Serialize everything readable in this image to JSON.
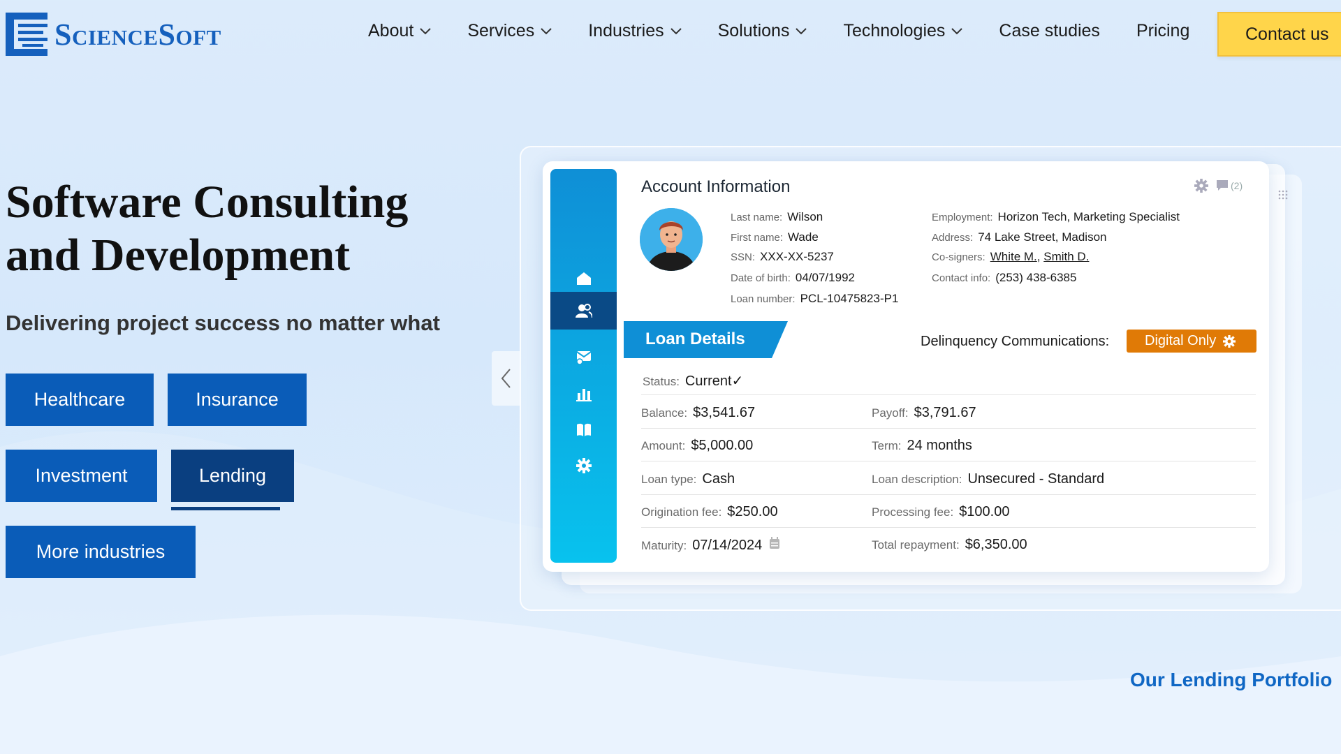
{
  "brand": {
    "name": "ScienceSoft",
    "color": "#1560bd"
  },
  "nav": {
    "items": [
      {
        "label": "About",
        "has_dropdown": true
      },
      {
        "label": "Services",
        "has_dropdown": true
      },
      {
        "label": "Industries",
        "has_dropdown": true
      },
      {
        "label": "Solutions",
        "has_dropdown": true
      },
      {
        "label": "Technologies",
        "has_dropdown": true
      },
      {
        "label": "Case studies",
        "has_dropdown": false
      },
      {
        "label": "Pricing",
        "has_dropdown": false
      }
    ],
    "contact_label": "Contact us"
  },
  "hero": {
    "title_line1": "Software Consulting",
    "title_line2": "and Development",
    "subtitle": "Delivering project success no matter what",
    "industries": [
      {
        "label": "Healthcare",
        "active": false
      },
      {
        "label": "Insurance",
        "active": false
      },
      {
        "label": "Investment",
        "active": false
      },
      {
        "label": "Lending",
        "active": true
      },
      {
        "label": "More industries",
        "active": false
      }
    ]
  },
  "mockup": {
    "sidebar_icons": [
      "home-icon",
      "users-icon",
      "mail-icon",
      "bar-chart-icon",
      "book-icon",
      "gear-icon"
    ],
    "account": {
      "title": "Account Information",
      "comment_count": "(2)",
      "last_name_label": "Last name:",
      "last_name": "Wilson",
      "first_name_label": "First name:",
      "first_name": "Wade",
      "ssn_label": "SSN:",
      "ssn": "XXX-XX-5237",
      "dob_label": "Date of birth:",
      "dob": "04/07/1992",
      "loan_number_label": "Loan number:",
      "loan_number": "PCL-10475823-P1",
      "employment_label": "Employment:",
      "employment": "Horizon Tech, Marketing Specialist",
      "address_label": "Address:",
      "address": "74 Lake Street, Madison",
      "cosigners_label": "Co-signers:",
      "cosigner1": "White M.",
      "cosigner_sep": ",",
      "cosigner2": "Smith D.",
      "contact_label": "Contact info:",
      "contact": "(253) 438-6385"
    },
    "loan": {
      "tab_label": "Loan Details",
      "delinquency_label": "Delinquency Communications:",
      "delinquency_value": "Digital Only",
      "status_label": "Status:",
      "status": "Current✓",
      "balance_label": "Balance:",
      "balance": "$3,541.67",
      "payoff_label": "Payoff:",
      "payoff": "$3,791.67",
      "amount_label": "Amount:",
      "amount": "$5,000.00",
      "term_label": "Term:",
      "term": "24 months",
      "loan_type_label": "Loan type:",
      "loan_type": "Cash",
      "loan_desc_label": "Loan description:",
      "loan_desc": "Unsecured - Standard",
      "origination_label": "Origination fee:",
      "origination": "$250.00",
      "processing_label": "Processing fee:",
      "processing": "$100.00",
      "maturity_label": "Maturity:",
      "maturity": "07/14/2024",
      "total_label": "Total repayment:",
      "total": "$6,350.00"
    }
  },
  "portfolio_link": "Our Lending Portfolio",
  "colors": {
    "primary": "#0a5cb8",
    "active": "#0a3f80",
    "accent_yellow": "#ffd54a",
    "orange": "#e07a06"
  }
}
